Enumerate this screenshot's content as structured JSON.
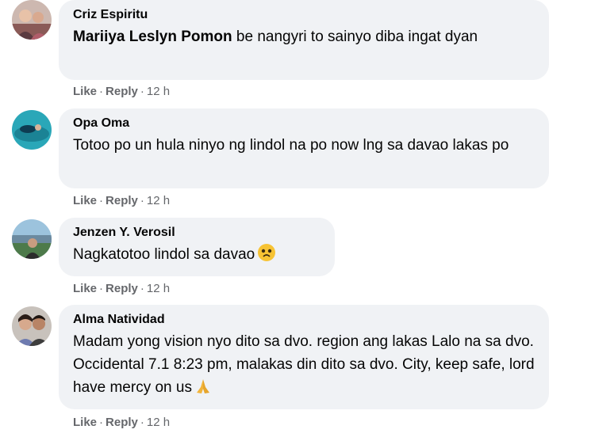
{
  "comments": [
    {
      "author": "Criz Espiritu",
      "mention": "Mariiya Leslyn Pomon",
      "text": " be nangyri to sainyo diba ingat dyan",
      "like": "Like",
      "reply": "Reply",
      "time": "12 h"
    },
    {
      "author": "Opa Oma",
      "text": "Totoo po un hula ninyo ng lindol na po now lng sa davao lakas po",
      "like": "Like",
      "reply": "Reply",
      "time": "12 h"
    },
    {
      "author": "Jenzen Y. Verosil",
      "text": "Nagkatotoo lindol sa davao",
      "emoji": "sad-face-emoji",
      "like": "Like",
      "reply": "Reply",
      "time": "12 h"
    },
    {
      "author": "Alma Natividad",
      "text": "Madam yong vision nyo dito sa dvo. region ang lakas Lalo na sa dvo. Occidental 7.1 8:23 pm, malakas din dito sa dvo. City, keep safe, lord have mercy on us",
      "emoji": "folded-hands-emoji",
      "like": "Like",
      "reply": "Reply",
      "time": "12 h"
    }
  ],
  "separator": "·",
  "colors": {
    "bubble": "#f0f2f5",
    "meta": "#65676b",
    "text": "#050505"
  }
}
